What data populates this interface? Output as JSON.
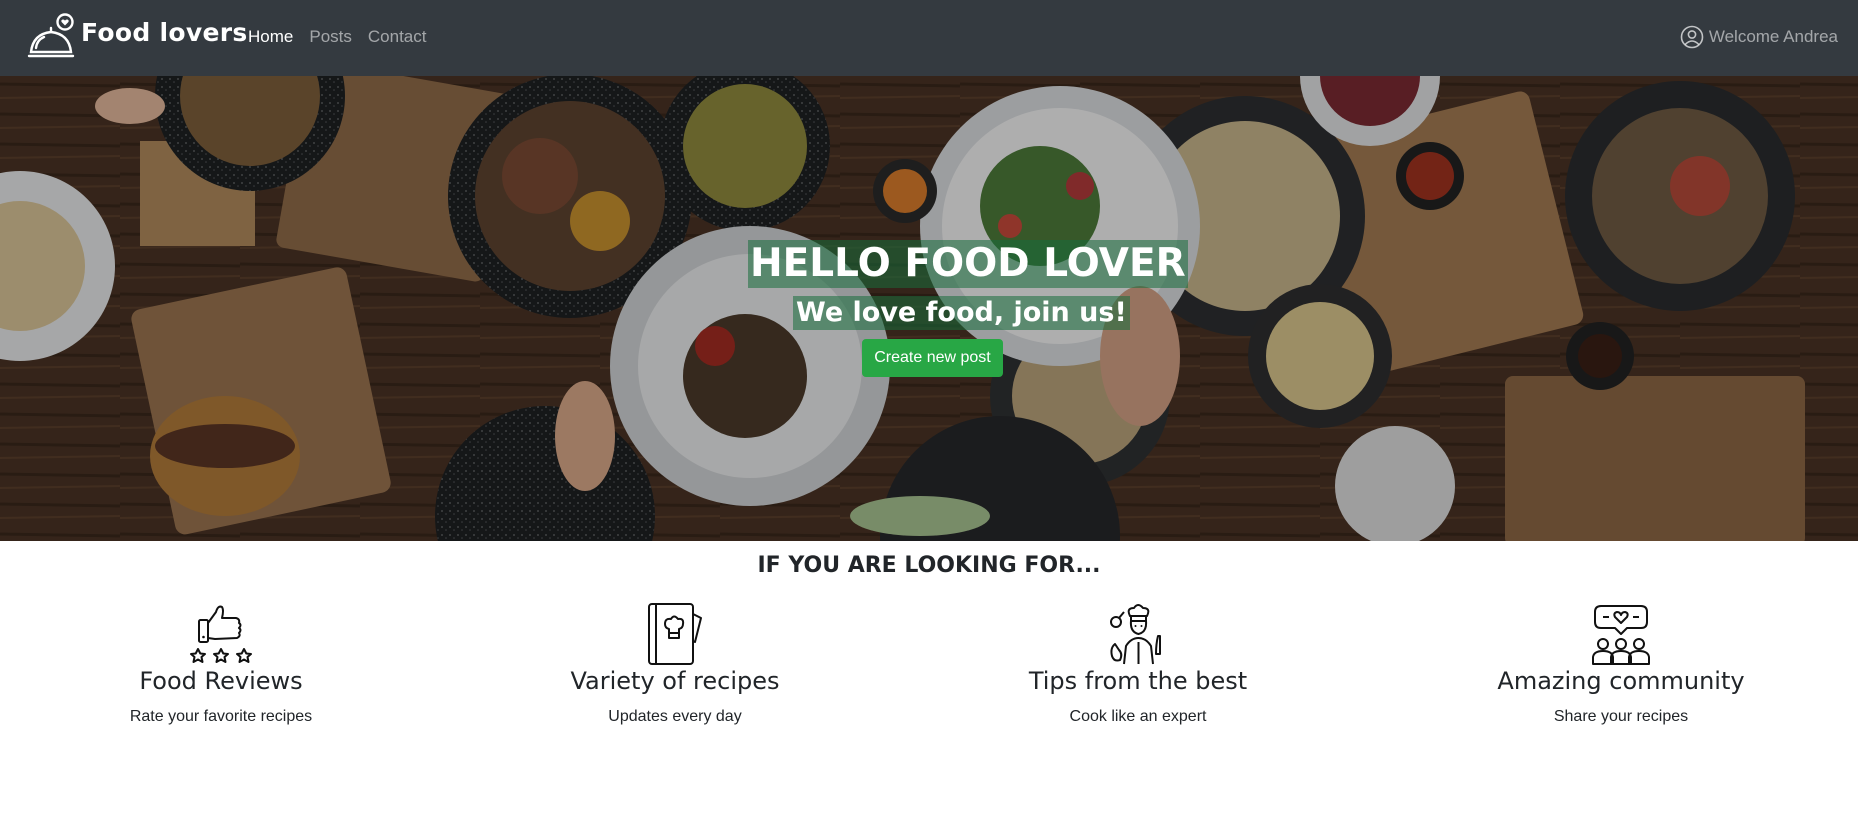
{
  "navbar": {
    "brand": "Food lovers",
    "links": [
      {
        "label": "Home",
        "active": true
      },
      {
        "label": "Posts",
        "active": false
      },
      {
        "label": "Contact",
        "active": false
      }
    ],
    "welcome": "Welcome Andrea"
  },
  "hero": {
    "title": "HELLO FOOD LOVER",
    "subtitle": "We love food, join us!",
    "button": "Create new post"
  },
  "features": {
    "heading": "IF YOU ARE LOOKING FOR...",
    "items": [
      {
        "icon": "thumbs-up-stars-icon",
        "title": "Food Reviews",
        "text": "Rate your favorite recipes"
      },
      {
        "icon": "recipe-book-icon",
        "title": "Variety of recipes",
        "text": "Updates every day"
      },
      {
        "icon": "chef-icon",
        "title": "Tips from the best",
        "text": "Cook like an expert"
      },
      {
        "icon": "community-icon",
        "title": "Amazing community",
        "text": "Share your recipes"
      }
    ]
  },
  "colors": {
    "navbar_bg": "#343a40",
    "accent_green": "#28a745",
    "text_dark": "#212529"
  }
}
